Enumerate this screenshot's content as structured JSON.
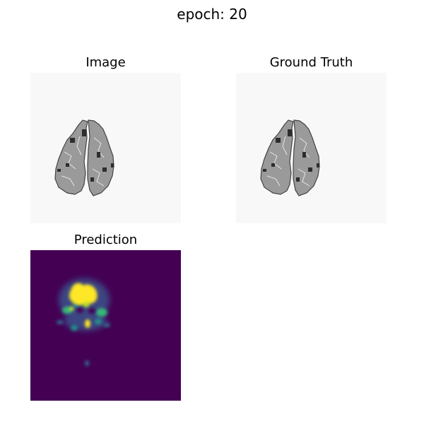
{
  "figure": {
    "title": "epoch: 20",
    "panels": [
      {
        "title": "Image",
        "kind": "grayscale-scan"
      },
      {
        "title": "Ground Truth",
        "kind": "grayscale-scan"
      },
      {
        "title": "Prediction",
        "kind": "heatmap"
      }
    ]
  },
  "colors": {
    "background": "#ffffff",
    "scan_background": "#f8f8f8",
    "scan_tissue": "#9a9a9a",
    "heatmap_background": "#440154",
    "heatmap_low": "#31688e",
    "heatmap_mid": "#35b779",
    "heatmap_high": "#fde725"
  }
}
